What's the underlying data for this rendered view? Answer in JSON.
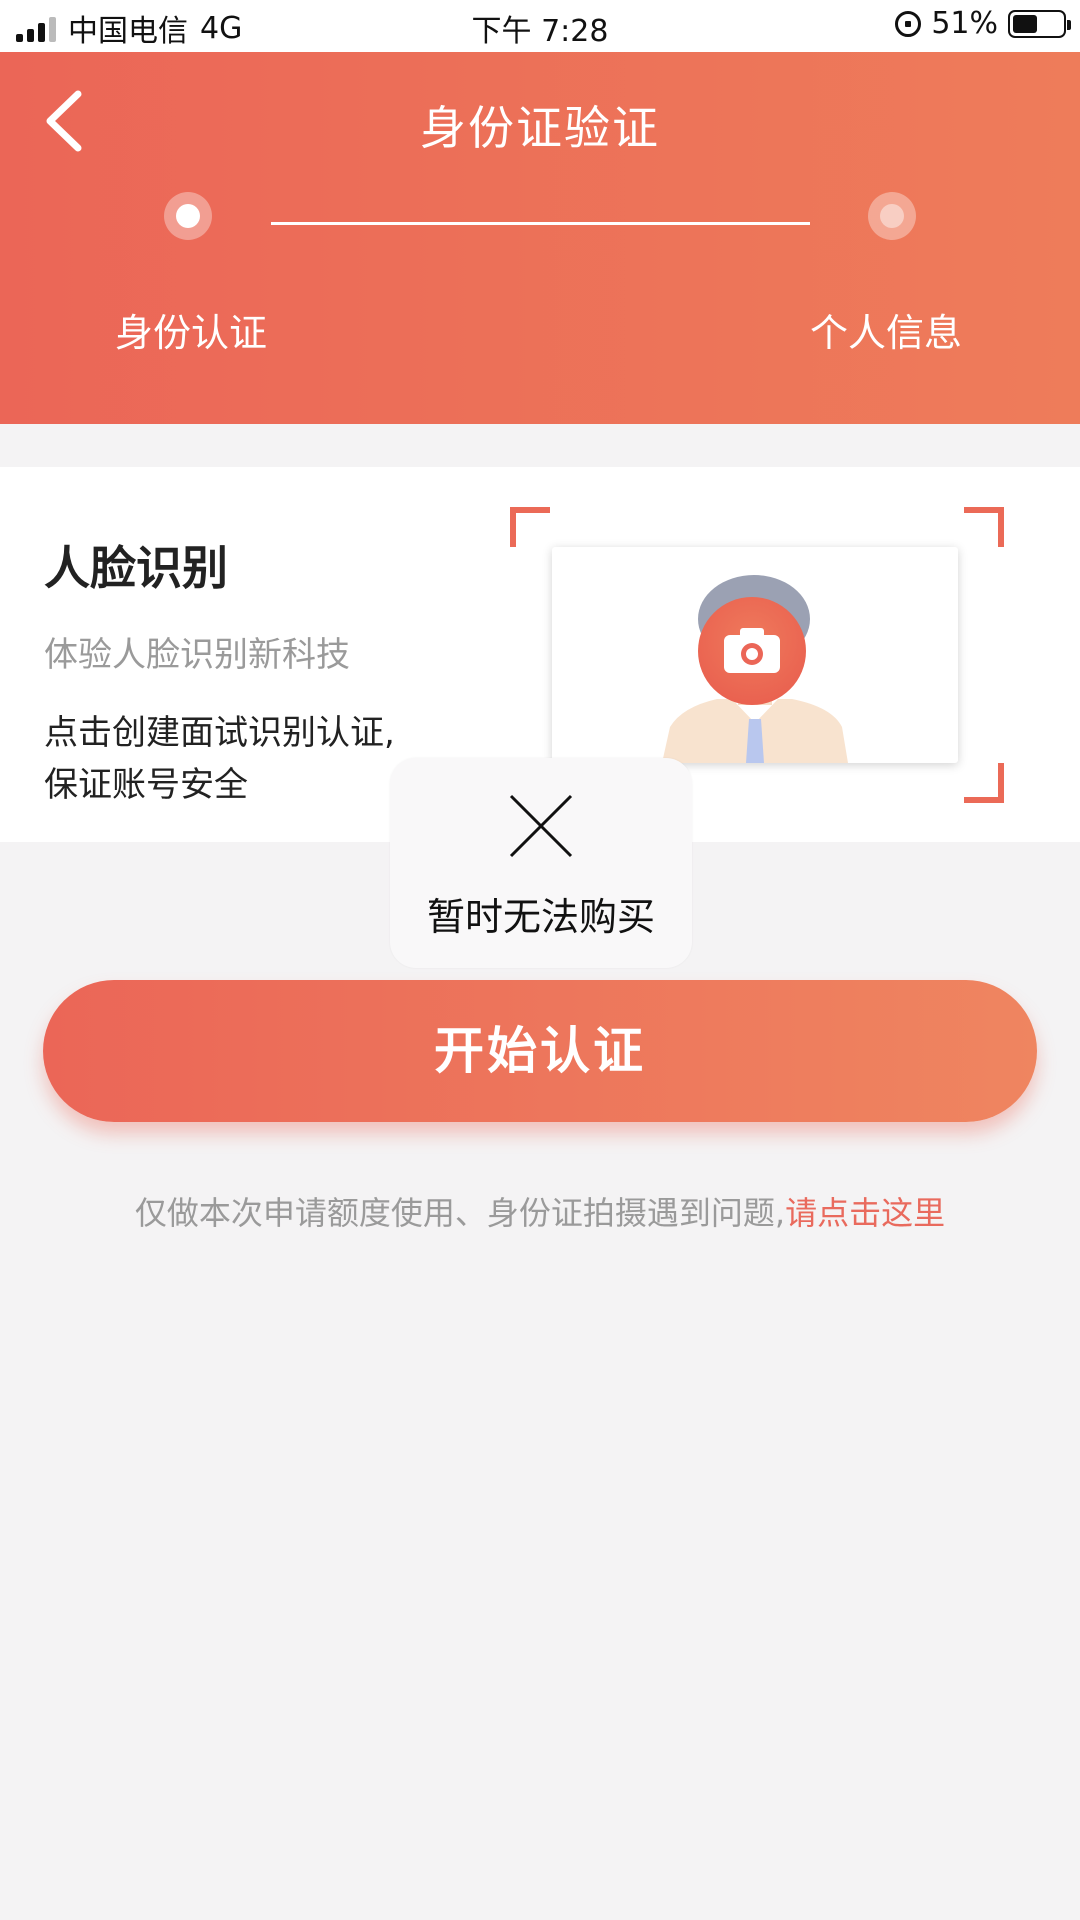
{
  "status_bar": {
    "carrier": "中国电信",
    "network": "4G",
    "time": "下午 7:28",
    "battery_percent": "51%",
    "battery_level": 0.51
  },
  "header": {
    "title": "身份证验证",
    "back_icon": "chevron-left-icon",
    "steps": [
      {
        "label": "身份认证",
        "active": true
      },
      {
        "label": "个人信息",
        "active": false
      }
    ],
    "gradient_start": "#eb6657",
    "gradient_end": "#ee7c5a"
  },
  "card": {
    "title": "人脸识别",
    "subtitle": "体验人脸识别新科技",
    "desc_line1": "点击创建面试识别认证,",
    "desc_line2": "保证账号安全",
    "photo_icon": "camera-icon"
  },
  "toast": {
    "icon": "close-icon",
    "message": "暂时无法购买"
  },
  "primary_button": {
    "label": "开始认证"
  },
  "note": {
    "text": "仅做本次申请额度使用、身份证拍摄遇到问题,",
    "link": "请点击这里"
  },
  "colors": {
    "accent": "#eb6657",
    "link": "#e96a5d",
    "background": "#f4f3f4"
  }
}
